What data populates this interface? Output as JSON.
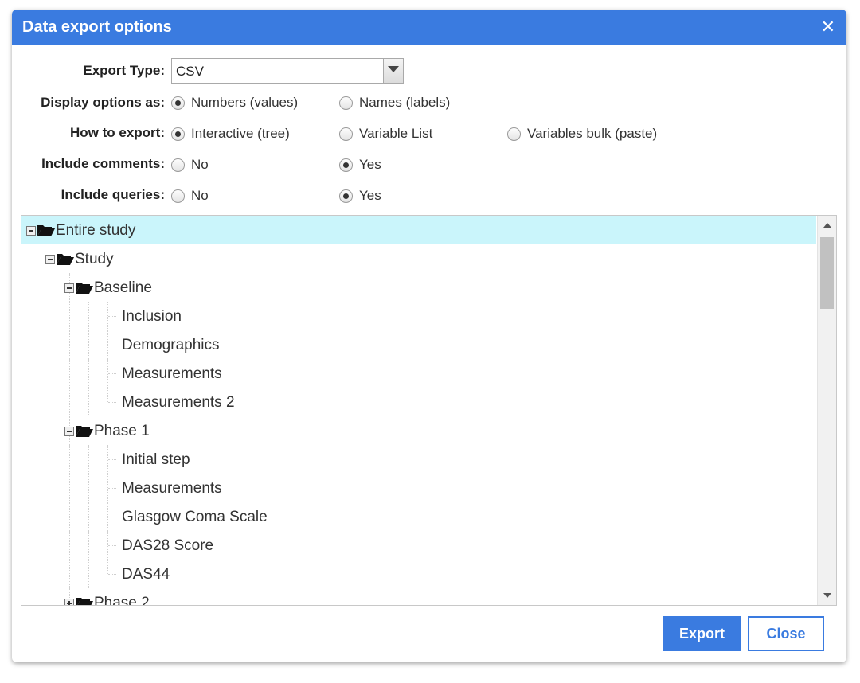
{
  "dialog": {
    "title": "Data export options",
    "close_glyph": "✕"
  },
  "form": {
    "export_type": {
      "label": "Export Type:",
      "value": "CSV"
    },
    "display_options": {
      "label": "Display options as:",
      "options": [
        "Numbers (values)",
        "Names (labels)"
      ],
      "selected": 0
    },
    "how_to_export": {
      "label": "How to export:",
      "options": [
        "Interactive (tree)",
        "Variable List",
        "Variables bulk (paste)"
      ],
      "selected": 0
    },
    "include_comments": {
      "label": "Include comments:",
      "options": [
        "No",
        "Yes"
      ],
      "selected": 1
    },
    "include_queries": {
      "label": "Include queries:",
      "options": [
        "No",
        "Yes"
      ],
      "selected": 1
    }
  },
  "tree": {
    "nodes": [
      {
        "label": "Entire study",
        "level": 0,
        "type": "folder",
        "expanded": true,
        "selected": true
      },
      {
        "label": "Study",
        "level": 1,
        "type": "folder",
        "expanded": true
      },
      {
        "label": "Baseline",
        "level": 2,
        "type": "folder",
        "expanded": true
      },
      {
        "label": "Inclusion",
        "level": 3,
        "type": "leaf"
      },
      {
        "label": "Demographics",
        "level": 3,
        "type": "leaf"
      },
      {
        "label": "Measurements",
        "level": 3,
        "type": "leaf"
      },
      {
        "label": "Measurements 2",
        "level": 3,
        "type": "leaf",
        "last": true
      },
      {
        "label": "Phase 1",
        "level": 2,
        "type": "folder",
        "expanded": true
      },
      {
        "label": "Initial step",
        "level": 3,
        "type": "leaf"
      },
      {
        "label": "Measurements",
        "level": 3,
        "type": "leaf"
      },
      {
        "label": "Glasgow Coma Scale",
        "level": 3,
        "type": "leaf"
      },
      {
        "label": "DAS28 Score",
        "level": 3,
        "type": "leaf"
      },
      {
        "label": "DAS44",
        "level": 3,
        "type": "leaf",
        "last": true
      },
      {
        "label": "Phase 2",
        "level": 2,
        "type": "folder",
        "expanded": false
      }
    ]
  },
  "buttons": {
    "export": "Export",
    "close": "Close"
  },
  "icons": {
    "folder": "folder-open-icon",
    "toggle_minus": "tree-collapse-icon",
    "toggle_plus": "tree-expand-icon",
    "close": "close-icon",
    "dropdown": "chevron-down-icon"
  },
  "colors": {
    "primary": "#3a7be0",
    "selected_row": "#caf5fb"
  }
}
